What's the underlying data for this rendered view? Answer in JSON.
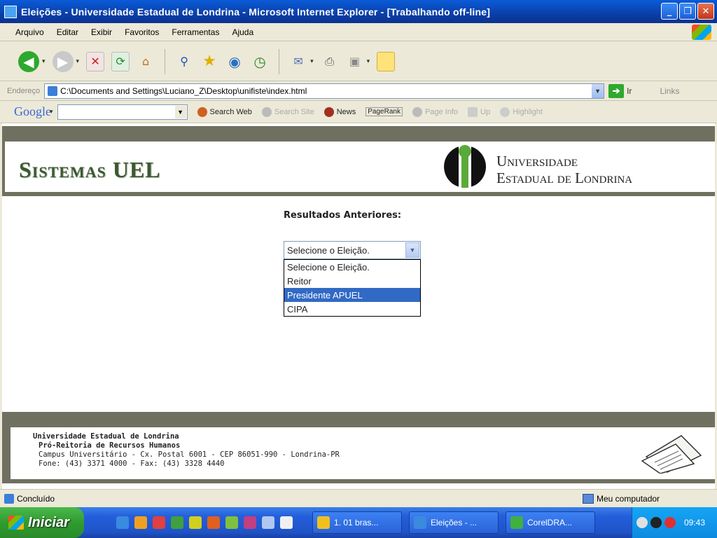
{
  "window": {
    "title": "Eleições - Universidade Estadual de Londrina - Microsoft Internet Explorer - [Trabalhando off-line]"
  },
  "menu": [
    "Arquivo",
    "Editar",
    "Exibir",
    "Favoritos",
    "Ferramentas",
    "Ajuda"
  ],
  "address": {
    "label": "Endereço",
    "url": "C:\\Documents and Settings\\Luciano_Z\\Desktop\\unifiste\\index.html",
    "go_label": "Ir",
    "links_label": "Links"
  },
  "googlebar": {
    "logo": "Google",
    "search_web": "Search Web",
    "search_site": "Search Site",
    "news": "News",
    "pagerank": "PageRank",
    "page_info": "Page Info",
    "up": "Up",
    "highlight": "Highlight"
  },
  "header": {
    "system_title": "Sistemas UEL",
    "university_line1": "Universidade",
    "university_line2": "Estadual de Londrina"
  },
  "main": {
    "results_label": "Resultados Anteriores:",
    "select_value": "Selecione o Eleição.",
    "options": [
      {
        "label": "Selecione o Eleição.",
        "selected": false
      },
      {
        "label": "Reitor",
        "selected": false
      },
      {
        "label": "Presidente APUEL",
        "selected": true
      },
      {
        "label": "CIPA",
        "selected": false
      }
    ]
  },
  "footer": {
    "line1": "Universidade Estadual de Londrina",
    "line2": "Pró-Reitoria de Recursos Humanos",
    "line3": "Campus Universitário - Cx. Postal 6001 - CEP 86051-990 - Londrina-PR",
    "line4": "Fone: (43) 3371 4000 - Fax: (43) 3328 4440"
  },
  "status": {
    "left": "Concluído",
    "right": "Meu computador"
  },
  "taskbar": {
    "start_label": "Iniciar",
    "tasks": [
      "1. 01 bras...",
      "Eleições - ...",
      "CorelDRA..."
    ],
    "clock": "09:43"
  },
  "colors": {
    "header_band": "#707060",
    "selection": "#316ac5",
    "uel_green": "#5aaa3a"
  }
}
